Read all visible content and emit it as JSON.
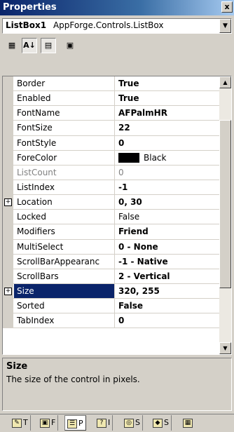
{
  "window": {
    "title": "Properties",
    "close_glyph": "x"
  },
  "object_selector": {
    "name": "ListBox1",
    "type": "AppForge.Controls.ListBox"
  },
  "toolbar": {
    "buttons": [
      {
        "name": "categorized-icon",
        "glyph": "▦"
      },
      {
        "name": "alphabetical-icon",
        "glyph": "A↓"
      },
      {
        "name": "properties-icon",
        "glyph": "▤"
      },
      {
        "name": "property-pages-icon",
        "glyph": "▣"
      }
    ]
  },
  "properties": [
    {
      "name": "Border",
      "value": "True",
      "bold": true
    },
    {
      "name": "Enabled",
      "value": "True",
      "bold": true
    },
    {
      "name": "FontName",
      "value": "AFPalmHR",
      "bold": true
    },
    {
      "name": "FontSize",
      "value": "22",
      "bold": true
    },
    {
      "name": "FontStyle",
      "value": "0",
      "bold": true
    },
    {
      "name": "ForeColor",
      "value": "Black",
      "bold": false,
      "swatch": "#000000"
    },
    {
      "name": "ListCount",
      "value": "0",
      "bold": false,
      "dim": true
    },
    {
      "name": "ListIndex",
      "value": "-1",
      "bold": true
    },
    {
      "name": "Location",
      "value": "0, 30",
      "bold": true,
      "expandable": true
    },
    {
      "name": "Locked",
      "value": "False",
      "bold": false
    },
    {
      "name": "Modifiers",
      "value": "Friend",
      "bold": true
    },
    {
      "name": "MultiSelect",
      "value": "0 - None",
      "bold": true
    },
    {
      "name": "ScrollBarAppearanc",
      "value": "-1 - Native",
      "bold": true
    },
    {
      "name": "ScrollBars",
      "value": "2 - Vertical",
      "bold": true
    },
    {
      "name": "Size",
      "value": "320, 255",
      "bold": true,
      "expandable": true,
      "selected": true
    },
    {
      "name": "Sorted",
      "value": "False",
      "bold": true
    },
    {
      "name": "TabIndex",
      "value": "0",
      "bold": true
    }
  ],
  "description": {
    "title": "Size",
    "text": "The size of the control in pixels."
  },
  "tabs": [
    {
      "label": "T"
    },
    {
      "label": "F"
    },
    {
      "label": "P"
    },
    {
      "label": "I"
    },
    {
      "label": "S"
    },
    {
      "label": "S"
    }
  ],
  "colors": {
    "selection": "#0a246a",
    "chrome": "#d4d0c8"
  }
}
